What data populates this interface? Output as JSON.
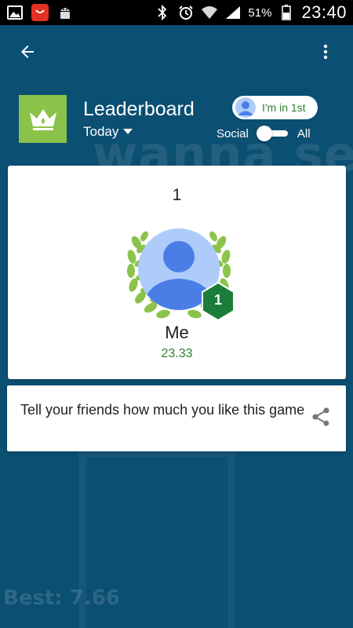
{
  "status_bar": {
    "battery_percent": "51%",
    "time": "23:40",
    "left_icons": [
      "gallery-icon",
      "aliexpress-icon",
      "android-debug-icon"
    ],
    "right_icons": [
      "bluetooth-icon",
      "alarm-icon",
      "wifi-icon",
      "signal-icon",
      "battery-icon"
    ]
  },
  "background": {
    "watermark_text": "wanna see",
    "best_text": "Best: 7.66"
  },
  "header": {
    "title": "Leaderboard",
    "time_filter": "Today",
    "rank_chip_label": "I'm in 1st",
    "toggle_left_label": "Social",
    "toggle_right_label": "All",
    "toggle_state": "social",
    "icon_color": "#8bc34a"
  },
  "player": {
    "rank": "1",
    "badge_rank": "1",
    "name": "Me",
    "score": "23.33"
  },
  "share": {
    "text": "Tell your friends how much you like this game"
  },
  "colors": {
    "background": "#0b4f72",
    "accent_green": "#2e7d32",
    "laurel_green": "#8bc34a",
    "badge_green": "#1b7d3a",
    "avatar_blue": "#4a7ee6"
  }
}
